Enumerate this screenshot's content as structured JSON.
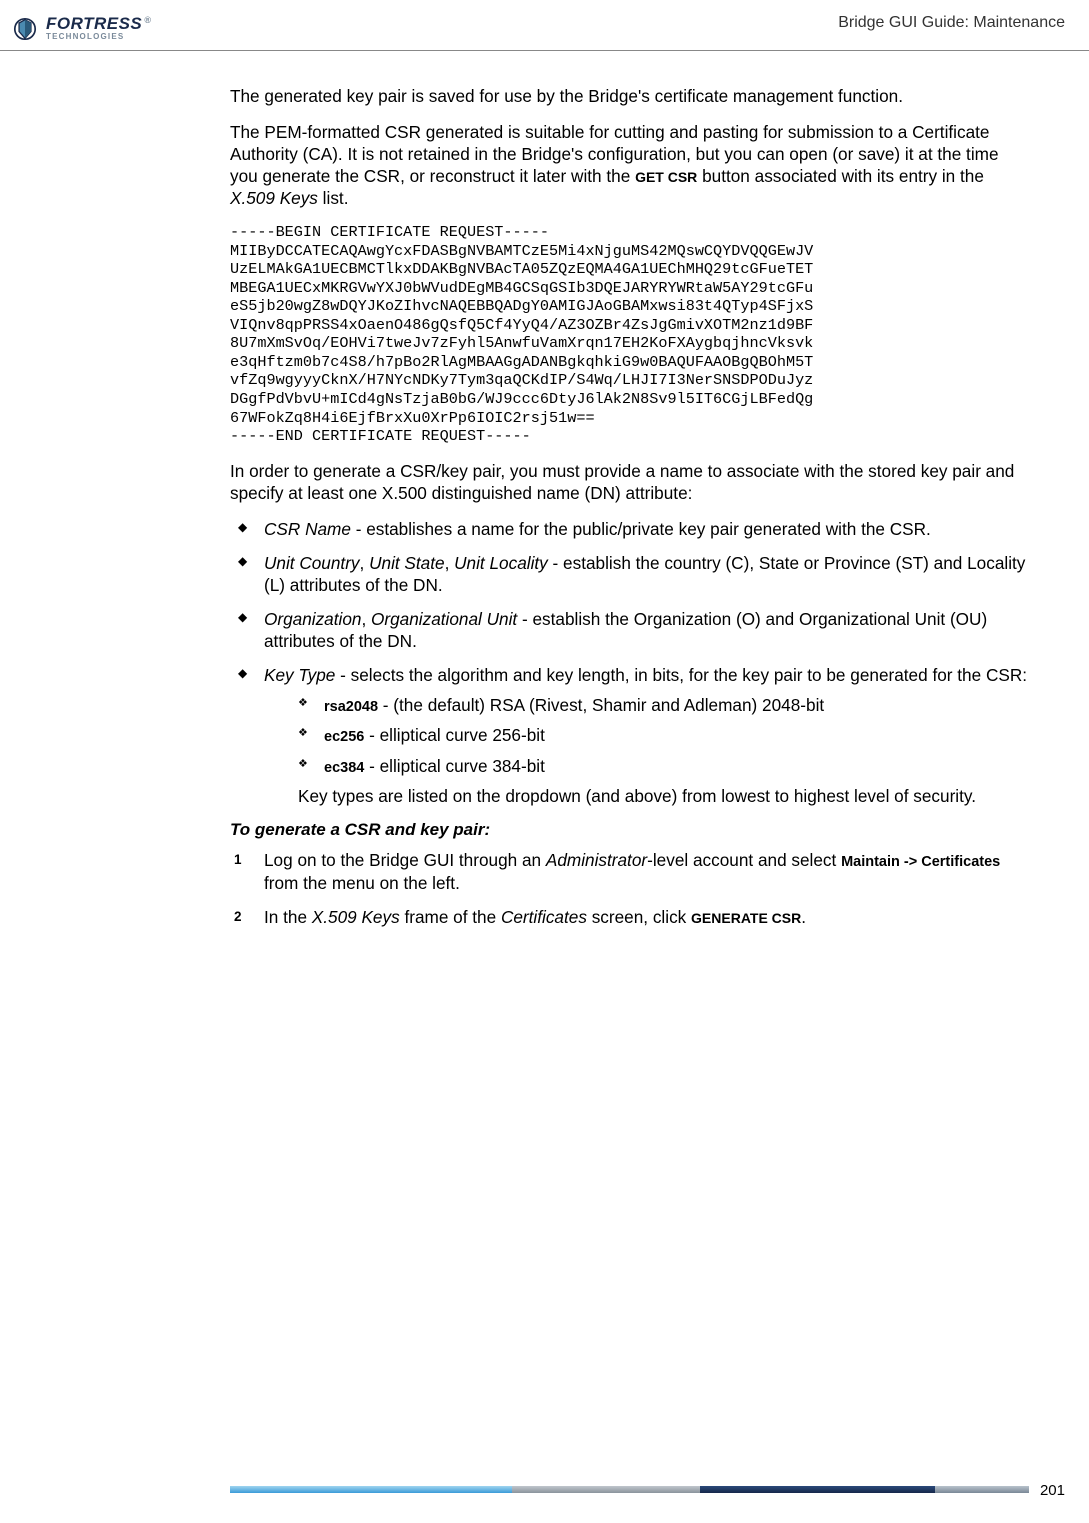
{
  "header": {
    "brand_main": "FORTRESS",
    "brand_sub": "TECHNOLOGIES",
    "title": "Bridge GUI Guide: Maintenance"
  },
  "intro": {
    "p1": "The generated key pair is saved for use by the Bridge's certificate management function.",
    "p2a": "The PEM-formatted CSR generated is suitable for cutting and pasting for submission to a Certificate Authority (CA). It is not retained in the Bridge's configuration, but you can open (or save) it at the time you generate the CSR, or reconstruct it later with the ",
    "p2_btn": "GET CSR",
    "p2b": " button associated with its entry in the ",
    "p2_list": "X.509 Keys",
    "p2c": " list."
  },
  "csr_block": "-----BEGIN CERTIFICATE REQUEST-----\nMIIByDCCATECAQAwgYcxFDASBgNVBAMTCzE5Mi4xNjguMS42MQswCQYDVQQGEwJV\nUzELMAkGA1UECBMCTlkxDDAKBgNVBAcTA05ZQzEQMA4GA1UEChMHQ29tcGFueTET\nMBEGA1UECxMKRGVwYXJ0bWVudDEgMB4GCSqGSIb3DQEJARYRYWRtaW5AY29tcGFu\neS5jb20wgZ8wDQYJKoZIhvcNAQEBBQADgY0AMIGJAoGBAMxwsi83t4QTyp4SFjxS\nVIQnv8qpPRSS4xOaenO486gQsfQ5Cf4YyQ4/AZ3OZBr4ZsJgGmivXOTM2nz1d9BF\n8U7mXmSvOq/EOHVi7tweJv7zFyhl5AnwfuVamXrqn17EH2KoFXAygbqjhncVksvk\ne3qHftzm0b7c4S8/h7pBo2RlAgMBAAGgADANBgkqhkiG9w0BAQUFAAOBgQBOhM5T\nvfZq9wgyyyCknX/H7NYcNDKy7Tym3qaQCKdIP/S4Wq/LHJI7I3NerSNSDPODuJyz\nDGgfPdVbvU+mICd4gNsTzjaB0bG/WJ9ccc6DtyJ6lAk2N8Sv9l5IT6CGjLBFedQg\n67WFokZq8H4i6EjfBrxXu0XrPp6IOIC2rsj51w==\n-----END CERTIFICATE REQUEST-----",
  "after_block": "In order to generate a CSR/key pair, you must provide a name to associate with the stored key pair and specify at least one X.500 distinguished name (DN) attribute:",
  "bullets": {
    "b1_name": "CSR Name",
    "b1_text": " - establishes a name for the public/private key pair generated with the CSR.",
    "b2_names": "Unit Country",
    "b2_sep1": ", ",
    "b2_name2": "Unit State",
    "b2_sep2": ", ",
    "b2_name3": "Unit Locality",
    "b2_text": " - establish the country (C), State or Province (ST) and Locality (L) attributes of the DN.",
    "b3_name1": "Organization",
    "b3_sep": ", ",
    "b3_name2": "Organizational Unit",
    "b3_text": " - establish the Organization (O) and Organizational Unit (OU) attributes of the DN.",
    "b4_name": "Key Type",
    "b4_text": " - selects the algorithm and key length, in bits, for the key pair to be generated for the CSR:",
    "sub1_key": "rsa2048",
    "sub1_text": " - (the default) RSA (Rivest, Shamir and Adleman) 2048-bit",
    "sub2_key": "ec256",
    "sub2_text": " - elliptical curve 256-bit",
    "sub3_key": "ec384",
    "sub3_text": " - elliptical curve 384-bit",
    "sub_note": "Key types are listed on the dropdown (and above) from lowest to highest level of security."
  },
  "procedure": {
    "heading": "To generate a CSR and key pair:",
    "s1a": "Log on to the Bridge GUI through an ",
    "s1_role": "Administrator",
    "s1b": "-level account and select ",
    "s1_menu": "Maintain -> Certificates",
    "s1c": " from the menu on the left.",
    "s2a": "In the ",
    "s2_frame": "X.509 Keys",
    "s2b": " frame of the ",
    "s2_screen": "Certificates",
    "s2c": " screen, click ",
    "s2_btn": "GENERATE CSR",
    "s2d": "."
  },
  "page_number": "201"
}
